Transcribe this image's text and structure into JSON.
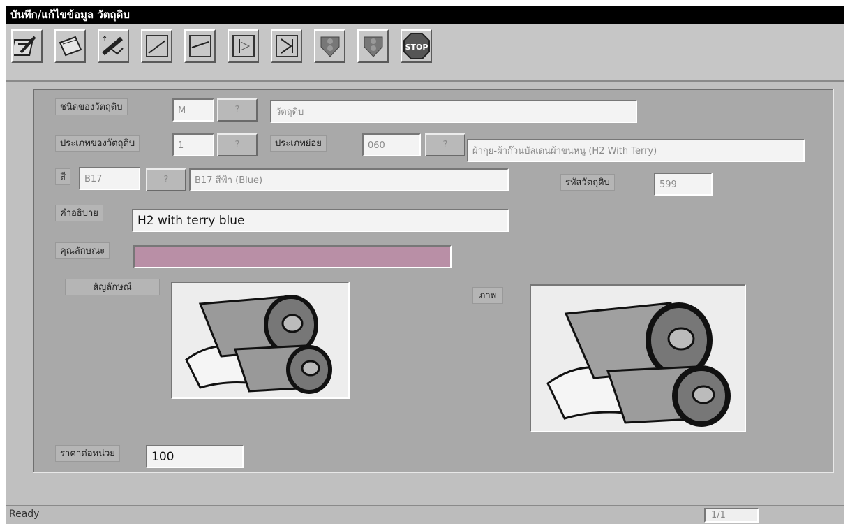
{
  "window": {
    "title": "บันทึก/แก้ไขข้อมูล วัตถุดิบ"
  },
  "toolbar": {
    "items": [
      {
        "name": "add-record-icon"
      },
      {
        "name": "edit-record-icon"
      },
      {
        "name": "delete-record-icon"
      },
      {
        "name": "first-record-icon"
      },
      {
        "name": "previous-record-icon"
      },
      {
        "name": "next-record-icon"
      },
      {
        "name": "last-record-icon"
      },
      {
        "name": "traffic-light-icon"
      },
      {
        "name": "traffic-light-icon"
      },
      {
        "name": "stop-icon",
        "label": "STOP"
      }
    ]
  },
  "form": {
    "material_type_label": "ชนิดของวัตถุดิบ",
    "material_type_code": "M",
    "material_type_name": "วัตถุดิบ",
    "category_label": "ประเภทของวัตถุดิบ",
    "category_code": "1",
    "subtype_label": "ประเภทย่อย",
    "subtype_code": "060",
    "subtype_name": "ผ้ากุย-ผ้าก๊วนบัลเดนผ้าขนหนู (H2 With Terry)",
    "color_label": "สี",
    "color_code": "B17",
    "color_name": "B17 สีฟ้า (Blue)",
    "material_code_label": "รหัสวัตถุดิบ",
    "material_code": "599",
    "description_label": "คำอธิบาย",
    "description": "H2 with terry blue",
    "property_label": "คุณลักษณะ",
    "property": "",
    "symbol_label": "สัญลักษณ์",
    "picture_label": "ภาพ",
    "unit_price_label": "ราคาต่อหน่วย",
    "unit_price": "100",
    "lookup_button": "?"
  },
  "status": {
    "text": "Ready",
    "record": "1/1"
  }
}
